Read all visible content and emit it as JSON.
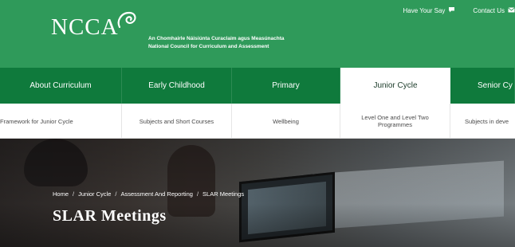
{
  "colors": {
    "header_green": "#2f9a5a",
    "nav_green": "#0f7a3c",
    "active_tab_bg": "#ffffff"
  },
  "header": {
    "logo_text": "NCCA",
    "org_name_irish": "An Chomhairle Náisiúnta Curaclaim agus Measúnachta",
    "org_name_english": "National Council for Curriculum and Assessment",
    "top_links": [
      {
        "label": "Have Your Say",
        "icon": "speech-bubble-icon"
      },
      {
        "label": "Contact Us",
        "icon": "envelope-icon"
      }
    ]
  },
  "main_nav": {
    "items": [
      {
        "label": "About Curriculum"
      },
      {
        "label": "Early Childhood"
      },
      {
        "label": "Primary"
      },
      {
        "label": "Junior Cycle",
        "active": true
      },
      {
        "label": "Senior Cy"
      }
    ]
  },
  "sub_nav": {
    "items": [
      {
        "label": "Framework for Junior Cycle"
      },
      {
        "label": "Subjects and Short Courses"
      },
      {
        "label": "Wellbeing"
      },
      {
        "label": "Level One and Level Two Programmes"
      },
      {
        "label": "Subjects in deve"
      }
    ]
  },
  "hero": {
    "breadcrumb": [
      {
        "label": "Home"
      },
      {
        "label": "Junior Cycle"
      },
      {
        "label": "Assessment And Reporting"
      },
      {
        "label": "SLAR Meetings"
      }
    ],
    "breadcrumb_separator": "/",
    "title": "SLAR Meetings"
  }
}
